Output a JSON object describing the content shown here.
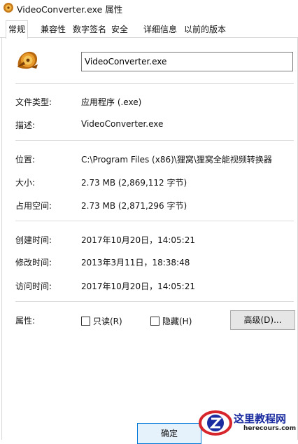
{
  "window": {
    "title": "VideoConverter.exe 属性"
  },
  "tabs": [
    {
      "label": "常规",
      "active": true
    },
    {
      "label": "兼容性"
    },
    {
      "label": "数字签名"
    },
    {
      "label": "安全"
    },
    {
      "label": "详细信息"
    },
    {
      "label": "以前的版本"
    }
  ],
  "general": {
    "file_name": "VideoConverter.exe",
    "file_type_label": "文件类型:",
    "file_type_value": "应用程序 (.exe)",
    "description_label": "描述:",
    "description_value": "VideoConverter.exe",
    "location_label": "位置:",
    "location_value": "C:\\Program Files (x86)\\狸窝\\狸窝全能视频转换器",
    "size_label": "大小:",
    "size_value": "2.73 MB (2,869,112 字节)",
    "size_on_disk_label": "占用空间:",
    "size_on_disk_value": "2.73 MB (2,871,296 字节)",
    "created_label": "创建时间:",
    "created_value": "2017年10月20日，14:05:21",
    "modified_label": "修改时间:",
    "modified_value": "2013年3月11日，18:38:48",
    "accessed_label": "访问时间:",
    "accessed_value": "2017年10月20日，14:05:21",
    "attributes_label": "属性:",
    "readonly_label": "只读(R)",
    "hidden_label": "隐藏(H)",
    "advanced_label": "高级(D)..."
  },
  "buttons": {
    "ok_label": "确定"
  },
  "watermark": {
    "title": "这里教程网",
    "subtitle": "herecours.com"
  },
  "icons": {
    "app": "video-converter-app-icon",
    "watermark_logo": "z-logo-icon"
  },
  "colors": {
    "accent": "#0078d7",
    "watermark_blue": "#1a2ca0",
    "watermark_red": "#d6252b"
  }
}
